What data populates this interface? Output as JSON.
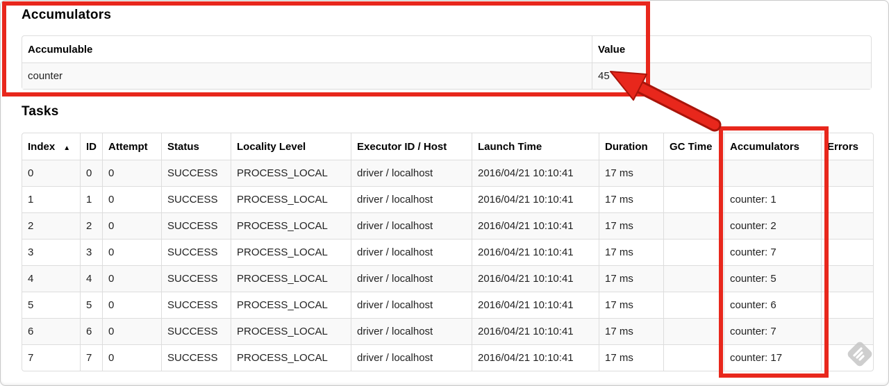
{
  "page": {
    "accumulators": {
      "heading": "Accumulators",
      "table": {
        "headers": [
          "Accumulable",
          "Value"
        ],
        "rows": [
          [
            "counter",
            "45"
          ]
        ]
      }
    },
    "tasks": {
      "heading": "Tasks",
      "table": {
        "sort": {
          "column": 0,
          "icon": "▲"
        },
        "headers": [
          "Index",
          "ID",
          "Attempt",
          "Status",
          "Locality Level",
          "Executor ID / Host",
          "Launch Time",
          "Duration",
          "GC Time",
          "Accumulators",
          "Errors"
        ],
        "rows": [
          [
            "0",
            "0",
            "0",
            "SUCCESS",
            "PROCESS_LOCAL",
            "driver / localhost",
            "2016/04/21 10:10:41",
            "17 ms",
            "",
            "",
            ""
          ],
          [
            "1",
            "1",
            "0",
            "SUCCESS",
            "PROCESS_LOCAL",
            "driver / localhost",
            "2016/04/21 10:10:41",
            "17 ms",
            "",
            "counter: 1",
            ""
          ],
          [
            "2",
            "2",
            "0",
            "SUCCESS",
            "PROCESS_LOCAL",
            "driver / localhost",
            "2016/04/21 10:10:41",
            "17 ms",
            "",
            "counter: 2",
            ""
          ],
          [
            "3",
            "3",
            "0",
            "SUCCESS",
            "PROCESS_LOCAL",
            "driver / localhost",
            "2016/04/21 10:10:41",
            "17 ms",
            "",
            "counter: 7",
            ""
          ],
          [
            "4",
            "4",
            "0",
            "SUCCESS",
            "PROCESS_LOCAL",
            "driver / localhost",
            "2016/04/21 10:10:41",
            "17 ms",
            "",
            "counter: 5",
            ""
          ],
          [
            "5",
            "5",
            "0",
            "SUCCESS",
            "PROCESS_LOCAL",
            "driver / localhost",
            "2016/04/21 10:10:41",
            "17 ms",
            "",
            "counter: 6",
            ""
          ],
          [
            "6",
            "6",
            "0",
            "SUCCESS",
            "PROCESS_LOCAL",
            "driver / localhost",
            "2016/04/21 10:10:41",
            "17 ms",
            "",
            "counter: 7",
            ""
          ],
          [
            "7",
            "7",
            "0",
            "SUCCESS",
            "PROCESS_LOCAL",
            "driver / localhost",
            "2016/04/21 10:10:41",
            "17 ms",
            "",
            "counter: 17",
            ""
          ]
        ]
      }
    },
    "icons": {
      "sort_ascending": "▲",
      "watermark": "skitch-watermark"
    },
    "colors": {
      "annotation_red": "#e8271c",
      "annotation_red_dark": "#a9140a",
      "table_border": "#dddddd",
      "row_stripe": "#f9f9f9"
    }
  }
}
